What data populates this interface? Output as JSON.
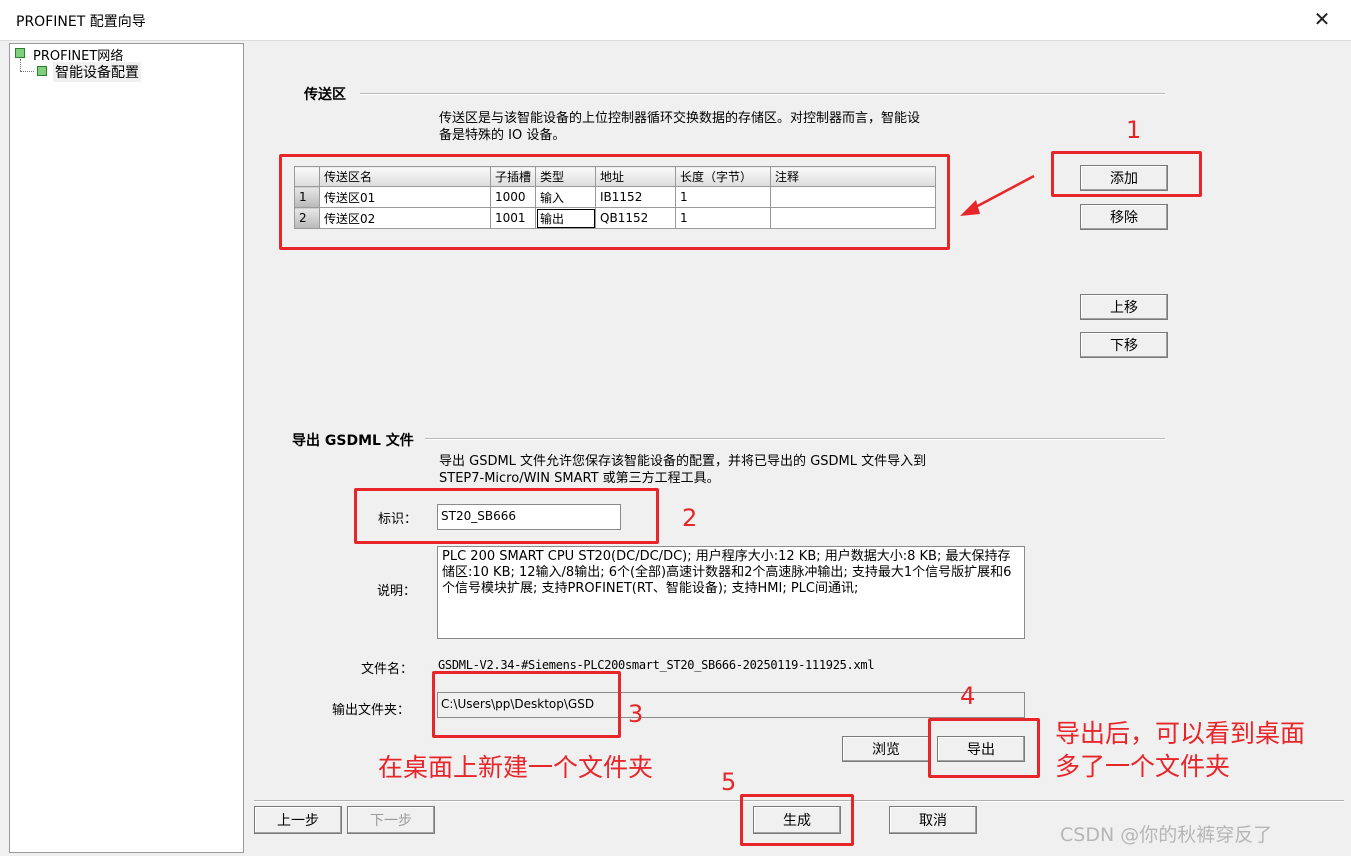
{
  "window": {
    "title": "PROFINET 配置向导",
    "close_glyph": "✕"
  },
  "tree": {
    "root": "PROFINET网络",
    "child": "智能设备配置"
  },
  "transfer": {
    "title": "传送区",
    "description_line1": "传送区是与该智能设备的上位控制器循环交换数据的存储区。对控制器而言，智能设",
    "description_line2": "备是特殊的 IO 设备。",
    "columns": [
      "传送区名",
      "子插槽",
      "类型",
      "地址",
      "长度（字节）",
      "注释"
    ],
    "rows": [
      [
        "1",
        "传送区01",
        "1000",
        "输入",
        "IB1152",
        "1",
        ""
      ],
      [
        "2",
        "传送区02",
        "1001",
        "输出",
        "QB1152",
        "1",
        ""
      ]
    ],
    "btn_add": "添加",
    "btn_remove": "移除",
    "btn_up": "上移",
    "btn_down": "下移"
  },
  "export": {
    "title": "导出 GSDML 文件",
    "description_line1": "导出 GSDML 文件允许您保存该智能设备的配置，并将已导出的 GSDML 文件导入到",
    "description_line2": "STEP7-Micro/WIN SMART 或第三方工程工具。",
    "id_label": "标识：",
    "id_value": "ST20_SB666",
    "desc_label": "说明：",
    "desc_value": "PLC 200 SMART CPU ST20(DC/DC/DC); 用户程序大小:12 KB; 用户数据大小:8 KB; 最大保持存储区:10 KB; 12输入/8输出; 6个(全部)高速计数器和2个高速脉冲输出; 支持最大1个信号版扩展和6个信号模块扩展; 支持PROFINET(RT、智能设备); 支持HMI; PLC间通讯;",
    "filename_label": "文件名：",
    "filename_value": "GSDML-V2.34-#Siemens-PLC200smart_ST20_SB666-20250119-111925.xml",
    "folder_label": "输出文件夹：",
    "folder_value": "C:\\Users\\pp\\Desktop\\GSD",
    "btn_browse": "浏览",
    "btn_export": "导出"
  },
  "footer": {
    "btn_prev": "上一步",
    "btn_next": "下一步",
    "btn_generate": "生成",
    "btn_cancel": "取消"
  },
  "annotations": {
    "n1": "1",
    "n2": "2",
    "n3": "3",
    "n4": "4",
    "n5": "5",
    "note_folder": "在桌面上新建一个文件夹",
    "note_export_line1": "导出后，可以看到桌面",
    "note_export_line2": "多了一个文件夹",
    "arrow_color": "#e8262a"
  },
  "watermark": "CSDN @你的秋裤穿反了"
}
